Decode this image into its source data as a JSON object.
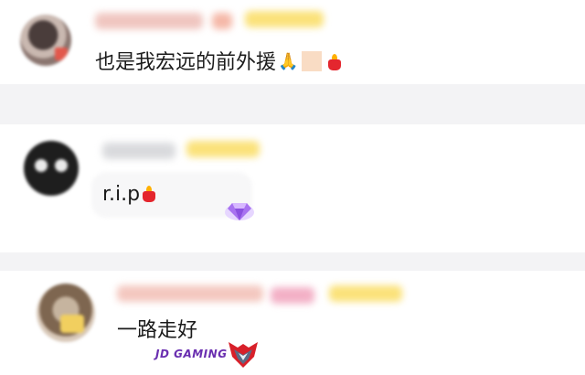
{
  "comments": [
    {
      "text": "也是我宏远的前外援"
    },
    {
      "text": "r.i.p"
    },
    {
      "text": "一路走好"
    }
  ],
  "badge": {
    "text": "JD GAMING"
  },
  "icons": [
    "pray-icon",
    "candle-icon",
    "diamond-badge-icon",
    "jdg-logo-icon"
  ],
  "colors": {
    "background": "#f3f3f5",
    "card": "#ffffff",
    "name_blur": "#f4c8c0",
    "tag_blur": "#f8dc63",
    "badge_text": "#6a2fb0"
  }
}
